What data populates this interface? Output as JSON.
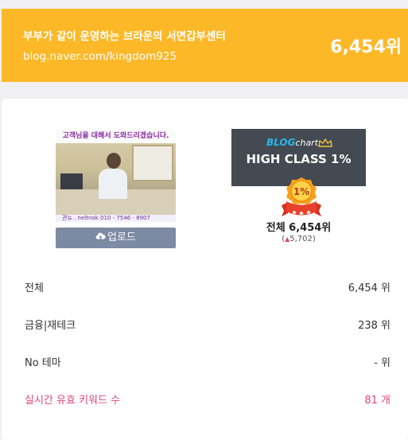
{
  "header": {
    "title": "부부가 같이 운영하는 브라운의 서면갑부센터",
    "url": "blog.naver.com/kingdom925",
    "rank": "6,454위"
  },
  "profile": {
    "photo_banner": "고객님을 대해서 도와드리겠습니다.",
    "photo_footer": "관뉴 . neltnok 010 - 7546 - 8907",
    "upload_label": "업로드"
  },
  "badge": {
    "logo_blog": "BLOG",
    "logo_chart": "chart",
    "class_label": "HIGH CLASS 1%",
    "medal_label": "1%",
    "total_rank": "전체 6,454위",
    "change_prefix": "(",
    "change_arrow": "▲",
    "change_value": "5,702",
    "change_suffix": ")"
  },
  "stats": [
    {
      "label": "전체",
      "value": "6,454 위"
    },
    {
      "label": "금융|재테크",
      "value": "238 위"
    },
    {
      "label": "No 테마",
      "value": "- 위"
    },
    {
      "label": "실시간 유효 키워드 수",
      "value": "81 개"
    }
  ],
  "colors": {
    "header_bg": "#fcb827",
    "badge_bg": "#434a51",
    "upload_bg": "#7d8aa4",
    "highlight": "#e0457b"
  }
}
